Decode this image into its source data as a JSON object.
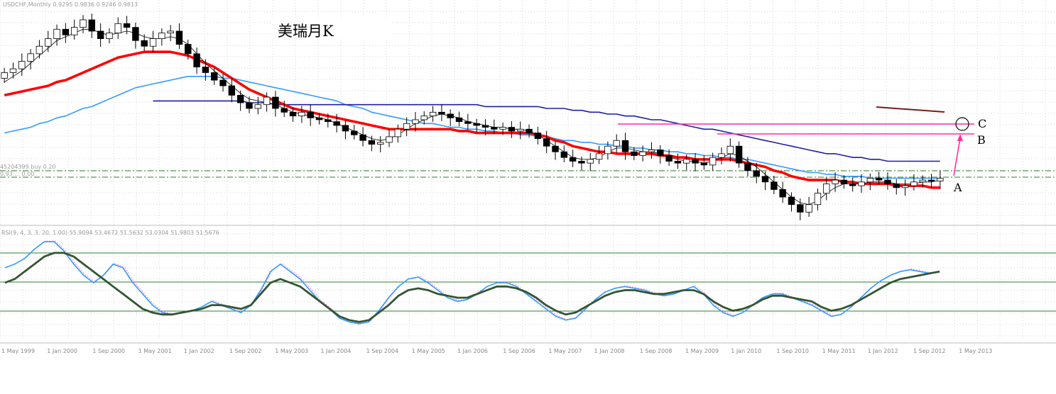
{
  "chart_data": [
    {
      "type": "candlestick",
      "title": "美瑞月K",
      "symbol_header": "USDCHF,Monthly  0.9295 0.9836 0.9246 0.9813",
      "price_level_labels": [
        "45204399 buy 0.20",
        "0.93 ... 0.00"
      ],
      "annotations": [
        {
          "label": "A",
          "description": "current candle, arrow pointing up toward B"
        },
        {
          "label": "B",
          "description": "horizontal magenta resistance line"
        },
        {
          "label": "C",
          "description": "circle marker on upper magenta line"
        }
      ],
      "time_labels": [
        "1 May 1999",
        "1 Jan 2000",
        "1 Sep 2000",
        "1 May 2001",
        "1 Jan 2002",
        "1 Sep 2002",
        "1 May 2003",
        "1 Jan 2004",
        "1 Sep 2004",
        "1 May 2005",
        "1 Jan 2006",
        "1 Sep 2006",
        "1 May 2007",
        "1 Jan 2008",
        "1 Sep 2008",
        "1 May 2009",
        "1 Jan 2010",
        "1 Sep 2010",
        "1 May 2011",
        "1 Jan 2012",
        "1 Sep 2012",
        "1 May 2013"
      ],
      "series": [
        {
          "name": "close",
          "color": "#000000",
          "values": [
            1.52,
            1.54,
            1.58,
            1.62,
            1.66,
            1.7,
            1.75,
            1.72,
            1.76,
            1.8,
            1.74,
            1.7,
            1.73,
            1.78,
            1.76,
            1.69,
            1.66,
            1.7,
            1.73,
            1.74,
            1.67,
            1.62,
            1.55,
            1.52,
            1.48,
            1.45,
            1.4,
            1.36,
            1.33,
            1.35,
            1.39,
            1.33,
            1.31,
            1.29,
            1.31,
            1.28,
            1.27,
            1.26,
            1.24,
            1.21,
            1.19,
            1.16,
            1.14,
            1.15,
            1.18,
            1.22,
            1.25,
            1.27,
            1.29,
            1.31,
            1.3,
            1.28,
            1.26,
            1.25,
            1.24,
            1.23,
            1.22,
            1.23,
            1.21,
            1.22,
            1.2,
            1.17,
            1.13,
            1.1,
            1.07,
            1.05,
            1.04,
            1.06,
            1.09,
            1.13,
            1.16,
            1.1,
            1.08,
            1.1,
            1.11,
            1.08,
            1.05,
            1.04,
            1.06,
            1.04,
            1.03,
            1.07,
            1.09,
            1.13,
            1.04,
            1.0,
            0.97,
            0.94,
            0.9,
            0.86,
            0.82,
            0.78,
            0.82,
            0.88,
            0.93,
            0.95,
            0.93,
            0.92,
            0.94,
            0.96,
            0.95,
            0.93,
            0.91,
            0.92,
            0.94,
            0.95,
            0.945,
            0.96
          ]
        },
        {
          "name": "MA thin black",
          "color": "#000000",
          "values": [
            1.47,
            1.5,
            1.53,
            1.57,
            1.61,
            1.65,
            1.69,
            1.71,
            1.73,
            1.75,
            1.75,
            1.73,
            1.72,
            1.73,
            1.74,
            1.73,
            1.71,
            1.7,
            1.7,
            1.71,
            1.7,
            1.67,
            1.62,
            1.57,
            1.53,
            1.49,
            1.45,
            1.41,
            1.38,
            1.37,
            1.36,
            1.35,
            1.33,
            1.31,
            1.3,
            1.29,
            1.28,
            1.27,
            1.25,
            1.23,
            1.21,
            1.19,
            1.17,
            1.16,
            1.17,
            1.19,
            1.22,
            1.25,
            1.27,
            1.29,
            1.3,
            1.29,
            1.28,
            1.26,
            1.25,
            1.24,
            1.23,
            1.23,
            1.22,
            1.22,
            1.21,
            1.19,
            1.16,
            1.13,
            1.1,
            1.07,
            1.06,
            1.06,
            1.07,
            1.1,
            1.12,
            1.12,
            1.11,
            1.1,
            1.1,
            1.09,
            1.07,
            1.06,
            1.05,
            1.05,
            1.04,
            1.05,
            1.07,
            1.09,
            1.08,
            1.05,
            1.02,
            0.98,
            0.94,
            0.9,
            0.86,
            0.83,
            0.82,
            0.84,
            0.88,
            0.91,
            0.93,
            0.93,
            0.93,
            0.94,
            0.94,
            0.94,
            0.93,
            0.93,
            0.93,
            0.94,
            0.94,
            0.95
          ]
        },
        {
          "name": "MA red thick",
          "color": "#ff0000",
          "values": [
            1.4,
            1.41,
            1.42,
            1.43,
            1.44,
            1.45,
            1.47,
            1.48,
            1.5,
            1.52,
            1.54,
            1.56,
            1.58,
            1.6,
            1.61,
            1.62,
            1.63,
            1.63,
            1.63,
            1.63,
            1.62,
            1.61,
            1.59,
            1.57,
            1.55,
            1.52,
            1.49,
            1.46,
            1.43,
            1.41,
            1.39,
            1.37,
            1.35,
            1.33,
            1.32,
            1.31,
            1.3,
            1.29,
            1.28,
            1.27,
            1.26,
            1.25,
            1.24,
            1.23,
            1.22,
            1.22,
            1.22,
            1.22,
            1.22,
            1.22,
            1.22,
            1.22,
            1.21,
            1.21,
            1.2,
            1.2,
            1.2,
            1.2,
            1.2,
            1.2,
            1.2,
            1.19,
            1.18,
            1.16,
            1.15,
            1.13,
            1.12,
            1.11,
            1.1,
            1.1,
            1.09,
            1.09,
            1.09,
            1.09,
            1.09,
            1.08,
            1.08,
            1.07,
            1.07,
            1.06,
            1.06,
            1.06,
            1.06,
            1.06,
            1.05,
            1.04,
            1.03,
            1.02,
            1.0,
            0.99,
            0.97,
            0.96,
            0.95,
            0.95,
            0.95,
            0.95,
            0.94,
            0.94,
            0.93,
            0.93,
            0.93,
            0.93,
            0.92,
            0.92,
            0.92,
            0.92,
            0.91,
            0.91
          ]
        },
        {
          "name": "MA light blue",
          "color": "#3399ff",
          "values": [
            1.2,
            1.21,
            1.22,
            1.23,
            1.25,
            1.26,
            1.28,
            1.29,
            1.31,
            1.33,
            1.34,
            1.36,
            1.38,
            1.4,
            1.42,
            1.44,
            1.45,
            1.46,
            1.47,
            1.48,
            1.49,
            1.5,
            1.5,
            1.5,
            1.5,
            1.49,
            1.49,
            1.48,
            1.47,
            1.46,
            1.45,
            1.44,
            1.43,
            1.42,
            1.41,
            1.4,
            1.39,
            1.38,
            1.37,
            1.35,
            1.34,
            1.33,
            1.31,
            1.3,
            1.29,
            1.28,
            1.27,
            1.26,
            1.25,
            1.25,
            1.24,
            1.23,
            1.23,
            1.22,
            1.22,
            1.21,
            1.21,
            1.2,
            1.2,
            1.19,
            1.19,
            1.18,
            1.18,
            1.17,
            1.16,
            1.16,
            1.15,
            1.15,
            1.14,
            1.14,
            1.13,
            1.13,
            1.12,
            1.12,
            1.11,
            1.11,
            1.1,
            1.1,
            1.09,
            1.09,
            1.08,
            1.08,
            1.07,
            1.07,
            1.06,
            1.06,
            1.05,
            1.04,
            1.03,
            1.02,
            1.01,
            1.0,
            0.99,
            0.99,
            0.98,
            0.98,
            0.97,
            0.97,
            0.97,
            0.96,
            0.96,
            0.96,
            0.96,
            0.96,
            0.96,
            0.96,
            0.96,
            0.96
          ]
        },
        {
          "name": "MA dark blue",
          "color": "#1f1fa0",
          "values": [
            null,
            null,
            null,
            null,
            null,
            null,
            null,
            null,
            null,
            null,
            null,
            null,
            null,
            null,
            null,
            null,
            null,
            1.37,
            1.37,
            1.37,
            1.37,
            1.37,
            1.37,
            1.37,
            1.37,
            1.37,
            1.37,
            1.37,
            1.36,
            1.36,
            1.36,
            1.35,
            1.35,
            1.35,
            1.35,
            1.35,
            1.35,
            1.35,
            1.35,
            1.35,
            1.35,
            1.35,
            1.35,
            1.35,
            1.35,
            1.35,
            1.35,
            1.35,
            1.35,
            1.35,
            1.35,
            1.35,
            1.35,
            1.35,
            1.35,
            1.34,
            1.34,
            1.34,
            1.34,
            1.34,
            1.34,
            1.34,
            1.33,
            1.33,
            1.33,
            1.32,
            1.32,
            1.31,
            1.31,
            1.3,
            1.3,
            1.29,
            1.29,
            1.28,
            1.27,
            1.27,
            1.26,
            1.25,
            1.24,
            1.23,
            1.22,
            1.22,
            1.21,
            1.2,
            1.19,
            1.18,
            1.17,
            1.16,
            1.15,
            1.14,
            1.13,
            1.12,
            1.11,
            1.1,
            1.09,
            1.09,
            1.08,
            1.07,
            1.07,
            1.06,
            1.06,
            1.05,
            1.05,
            1.05,
            1.05,
            1.05,
            1.05,
            1.05
          ]
        },
        {
          "name": "RSI smoothed (dark green)",
          "color": "#335533",
          "values": [
            50,
            52,
            56,
            60,
            64,
            66,
            66,
            64,
            60,
            56,
            52,
            48,
            44,
            40,
            36,
            34,
            33,
            33,
            34,
            35,
            36,
            38,
            38,
            37,
            36,
            38,
            44,
            50,
            52,
            50,
            48,
            44,
            40,
            36,
            32,
            30,
            29,
            30,
            34,
            38,
            43,
            46,
            47,
            46,
            44,
            43,
            42,
            42,
            44,
            46,
            48,
            48,
            47,
            45,
            42,
            38,
            35,
            33,
            34,
            37,
            40,
            43,
            45,
            46,
            46,
            45,
            44,
            44,
            45,
            46,
            46,
            44,
            40,
            37,
            35,
            36,
            38,
            41,
            43,
            43,
            42,
            41,
            40,
            37,
            35,
            36,
            38,
            41,
            44,
            47,
            50,
            52,
            53,
            54,
            55,
            56
          ]
        },
        {
          "name": "RSI fast (blue)",
          "color": "#3399ff",
          "values": [
            58,
            60,
            63,
            68,
            72,
            72,
            67,
            60,
            54,
            50,
            54,
            60,
            58,
            50,
            44,
            38,
            34,
            33,
            34,
            35,
            37,
            40,
            38,
            36,
            34,
            38,
            46,
            56,
            60,
            56,
            52,
            46,
            40,
            36,
            31,
            29,
            28,
            29,
            35,
            42,
            48,
            52,
            53,
            50,
            46,
            42,
            40,
            41,
            44,
            48,
            50,
            50,
            48,
            44,
            40,
            36,
            32,
            30,
            31,
            36,
            41,
            45,
            47,
            48,
            47,
            46,
            44,
            43,
            44,
            46,
            48,
            44,
            38,
            34,
            32,
            34,
            38,
            42,
            44,
            44,
            42,
            40,
            38,
            35,
            32,
            33,
            37,
            42,
            47,
            51,
            54,
            56,
            57,
            56,
            55,
            56
          ]
        }
      ]
    }
  ]
}
